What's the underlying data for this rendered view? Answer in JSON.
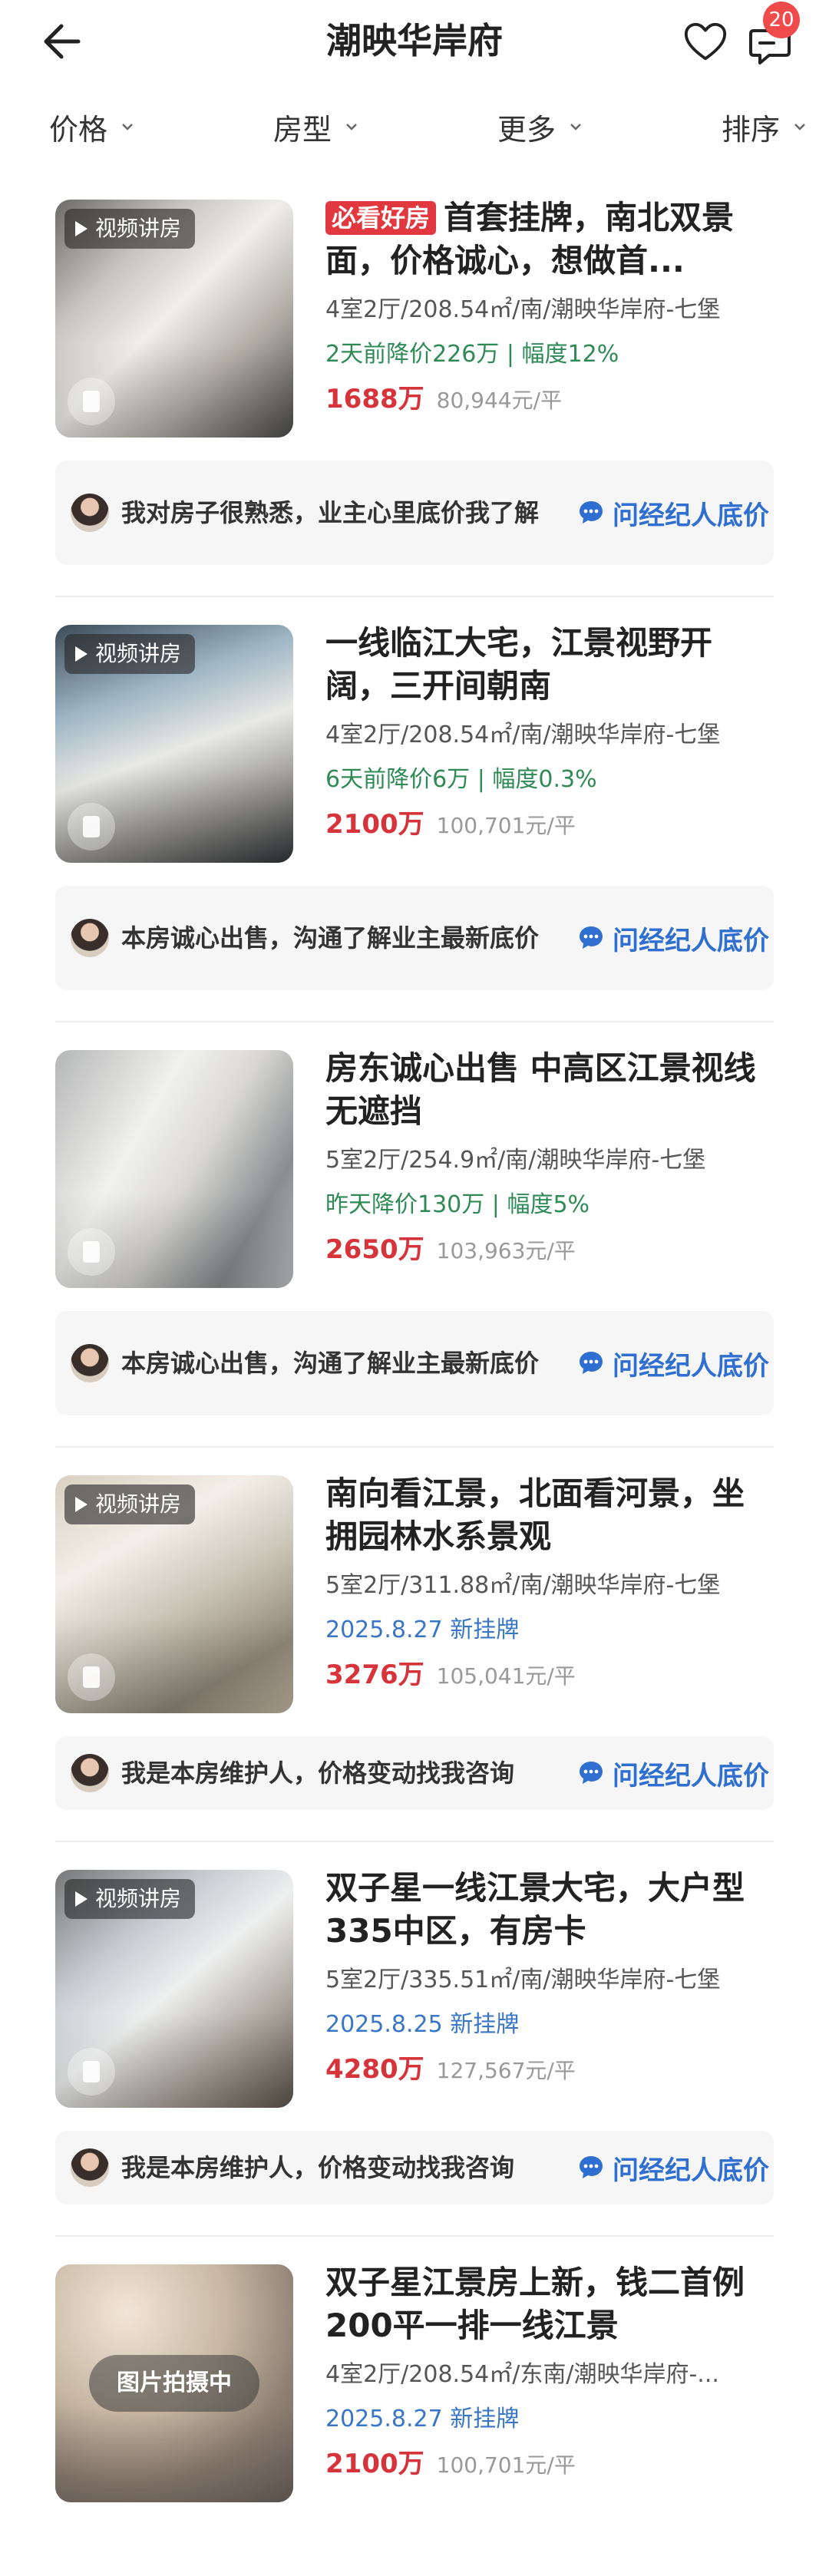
{
  "header": {
    "title": "潮映华岸府",
    "message_badge": "20"
  },
  "filters": [
    "价格",
    "房型",
    "更多",
    "排序"
  ],
  "listings": [
    {
      "tag": "必看好房",
      "title": "首套挂牌，南北双景面，价格诚心，想做首...",
      "meta": "4室2厅/208.54㎡/南/潮映华岸府-七堡",
      "status_type": "price_change",
      "status": "2天前降价226万 | 幅度12%",
      "price": "1688万",
      "unit_price": "80,944元/平",
      "video_label": "视频讲房",
      "agent_text": "我对房子很熟悉，业主心里底价我了解",
      "ask_label": "问经纪人底价"
    },
    {
      "tag": "",
      "title": "一线临江大宅，江景视野开阔，三开间朝南",
      "meta": "4室2厅/208.54㎡/南/潮映华岸府-七堡",
      "status_type": "price_change",
      "status": "6天前降价6万 | 幅度0.3%",
      "price": "2100万",
      "unit_price": "100,701元/平",
      "video_label": "视频讲房",
      "agent_text": "本房诚心出售，沟通了解业主最新底价",
      "ask_label": "问经纪人底价"
    },
    {
      "tag": "",
      "title": "房东诚心出售 中高区江景视线无遮挡",
      "meta": "5室2厅/254.9㎡/南/潮映华岸府-七堡",
      "status_type": "price_change",
      "status": "昨天降价130万 | 幅度5%",
      "price": "2650万",
      "unit_price": "103,963元/平",
      "video_label": "",
      "agent_text": "本房诚心出售，沟通了解业主最新底价",
      "ask_label": "问经纪人底价"
    },
    {
      "tag": "",
      "title": "南向看江景，北面看河景，坐拥园林水系景观",
      "meta": "5室2厅/311.88㎡/南/潮映华岸府-七堡",
      "status_type": "listed",
      "status": "2025.8.27 新挂牌",
      "price": "3276万",
      "unit_price": "105,041元/平",
      "video_label": "视频讲房",
      "agent_text": "我是本房维护人，价格变动找我咨询",
      "ask_label": "问经纪人底价"
    },
    {
      "tag": "",
      "title": "双子星一线江景大宅，大户型335中区，有房卡",
      "meta": "5室2厅/335.51㎡/南/潮映华岸府-七堡",
      "status_type": "listed",
      "status": "2025.8.25 新挂牌",
      "price": "4280万",
      "unit_price": "127,567元/平",
      "video_label": "视频讲房",
      "agent_text": "我是本房维护人，价格变动找我咨询",
      "ask_label": "问经纪人底价"
    },
    {
      "tag": "",
      "title": "双子星江景房上新，钱二首例200平一排一线江景",
      "meta": "4室2厅/208.54㎡/东南/潮映华岸府-...",
      "status_type": "listed",
      "status": "2025.8.27 新挂牌",
      "price": "2100万",
      "unit_price": "100,701元/平",
      "video_label": "",
      "shooting_label": "图片拍摄中",
      "agent_text": "",
      "ask_label": ""
    }
  ],
  "colors": {
    "price_red": "#d7333a",
    "price_drop_green": "#2f8a56",
    "new_listing_blue": "#3a76c6",
    "ask_blue": "#2f6fd1",
    "badge_red": "#ef4b4b"
  }
}
